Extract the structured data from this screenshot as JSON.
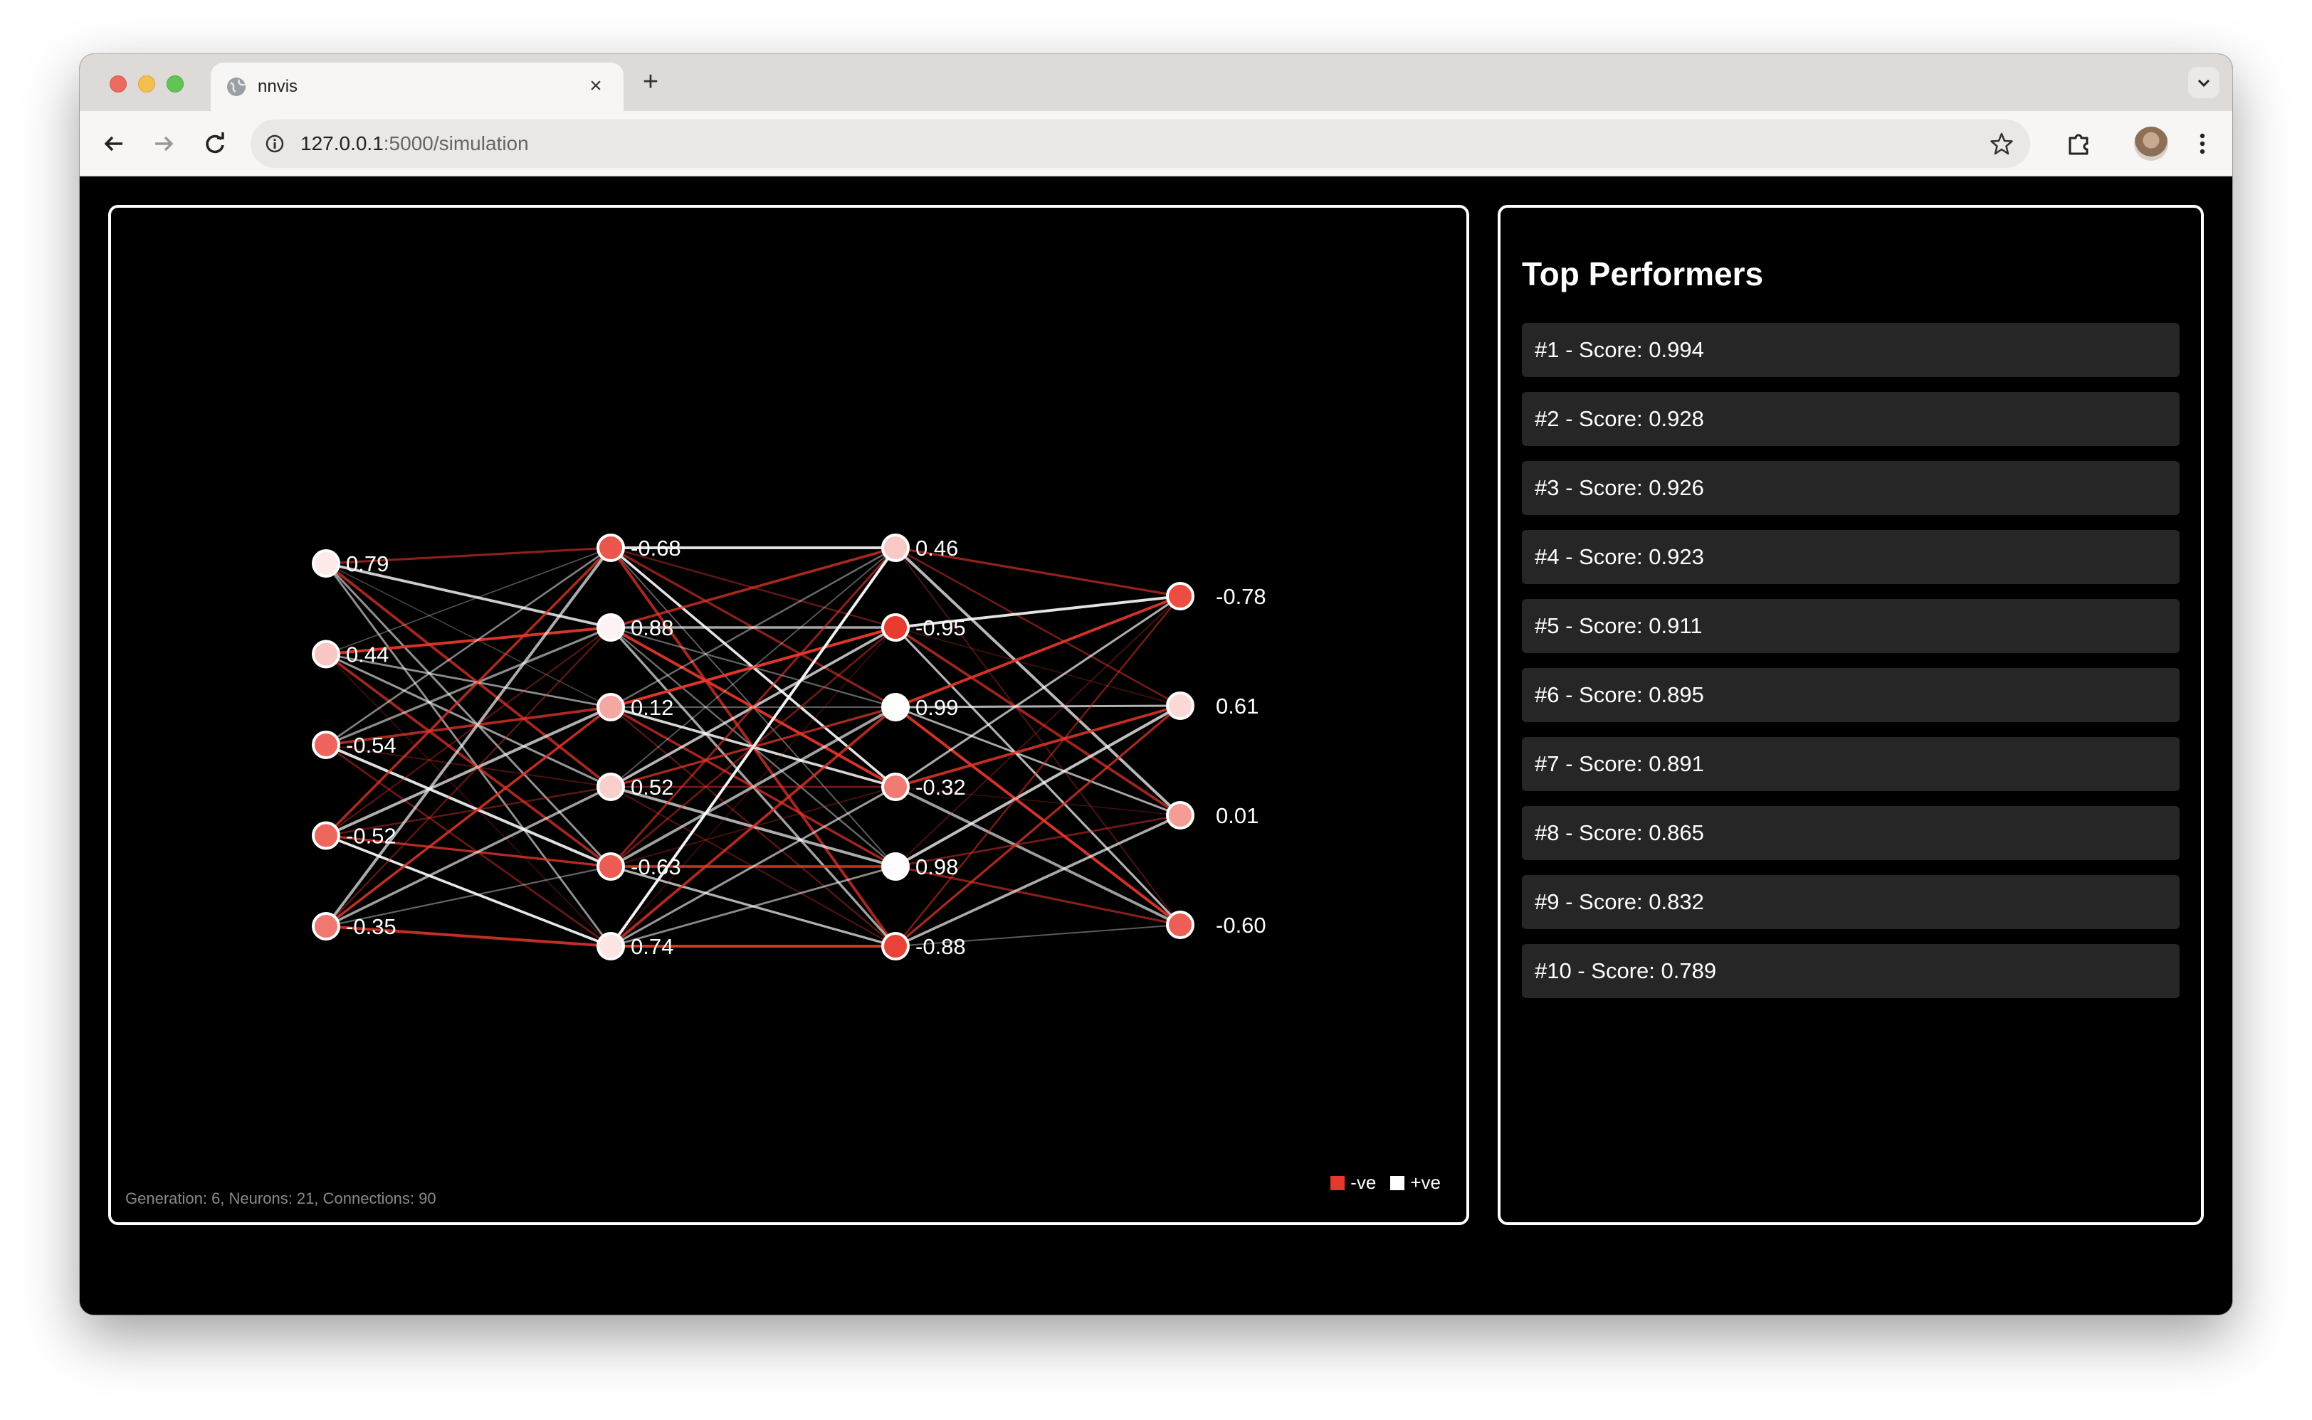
{
  "browser": {
    "tab_title": "nnvis",
    "url_host": "127.0.0.1",
    "url_rest": ":5000/simulation"
  },
  "network": {
    "layers": [
      [
        0.79,
        0.44,
        -0.54,
        -0.52,
        -0.35
      ],
      [
        -0.68,
        0.88,
        0.12,
        0.52,
        -0.63,
        0.74
      ],
      [
        0.46,
        -0.95,
        0.99,
        -0.32,
        0.98,
        -0.88
      ],
      [
        -0.78,
        0.61,
        0.01,
        -0.6
      ]
    ],
    "colors": {
      "negative": "#e8372b",
      "positive": "#ffffff"
    }
  },
  "status": "Generation: 6, Neurons: 21, Connections: 90",
  "legend": {
    "negative_label": "-ve",
    "positive_label": "+ve"
  },
  "performers": {
    "title": "Top Performers",
    "items": [
      "#1 - Score: 0.994",
      "#2 - Score: 0.928",
      "#3 - Score: 0.926",
      "#4 - Score: 0.923",
      "#5 - Score: 0.911",
      "#6 - Score: 0.895",
      "#7 - Score: 0.891",
      "#8 - Score: 0.865",
      "#9 - Score: 0.832",
      "#10 - Score: 0.789"
    ]
  }
}
